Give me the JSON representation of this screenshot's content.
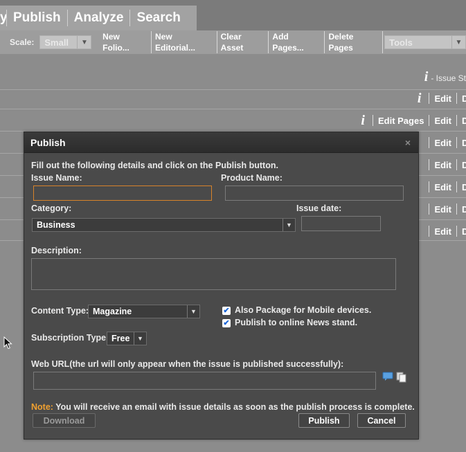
{
  "nav": {
    "tabs": [
      "y",
      "Publish",
      "Analyze",
      "Search"
    ]
  },
  "toolbar": {
    "scale_label": "Scale:",
    "scale_value": "Small",
    "actions": [
      "New Folio...",
      "New Editorial...",
      "Clear Asset",
      "Add Pages...",
      "Delete Pages"
    ],
    "tools_value": "Tools"
  },
  "background": {
    "issue_status_label": "- Issue St",
    "edit_label": "Edit",
    "edit_pages_label": "Edit Pages",
    "d_label": "D"
  },
  "dialog": {
    "title": "Publish",
    "close_glyph": "×",
    "intro": "Fill out the following details and click on the Publish button.",
    "issue_name_label": "Issue Name:",
    "issue_name_value": "",
    "product_name_label": "Product Name:",
    "product_name_value": "",
    "category_label": "Category:",
    "category_value": "Business",
    "issue_date_label": "Issue date:",
    "issue_date_value": "",
    "description_label": "Description:",
    "description_value": "",
    "content_type_label": "Content Type:",
    "content_type_value": "Magazine",
    "mobile_package_label": "Also Package for Mobile devices.",
    "mobile_package_checked": true,
    "newsstand_label": "Publish to online News stand.",
    "newsstand_checked": true,
    "subscription_type_label": "Subscription Type:",
    "subscription_type_value": "Free",
    "web_url_label": "Web URL(the url will only appear when the issue is published successfully):",
    "web_url_value": "",
    "note_label": "Note:",
    "note_text": " You will receive an email with issue details as soon as the publish process is complete.",
    "download_label": "Download",
    "publish_label": "Publish",
    "cancel_label": "Cancel"
  },
  "icons": {
    "checkmark": "✔",
    "dropdown": "▼",
    "info": "i"
  },
  "colors": {
    "accent_orange": "#d8832a",
    "note_orange": "#f0a030",
    "dialog_bg": "#4a4a4a"
  }
}
